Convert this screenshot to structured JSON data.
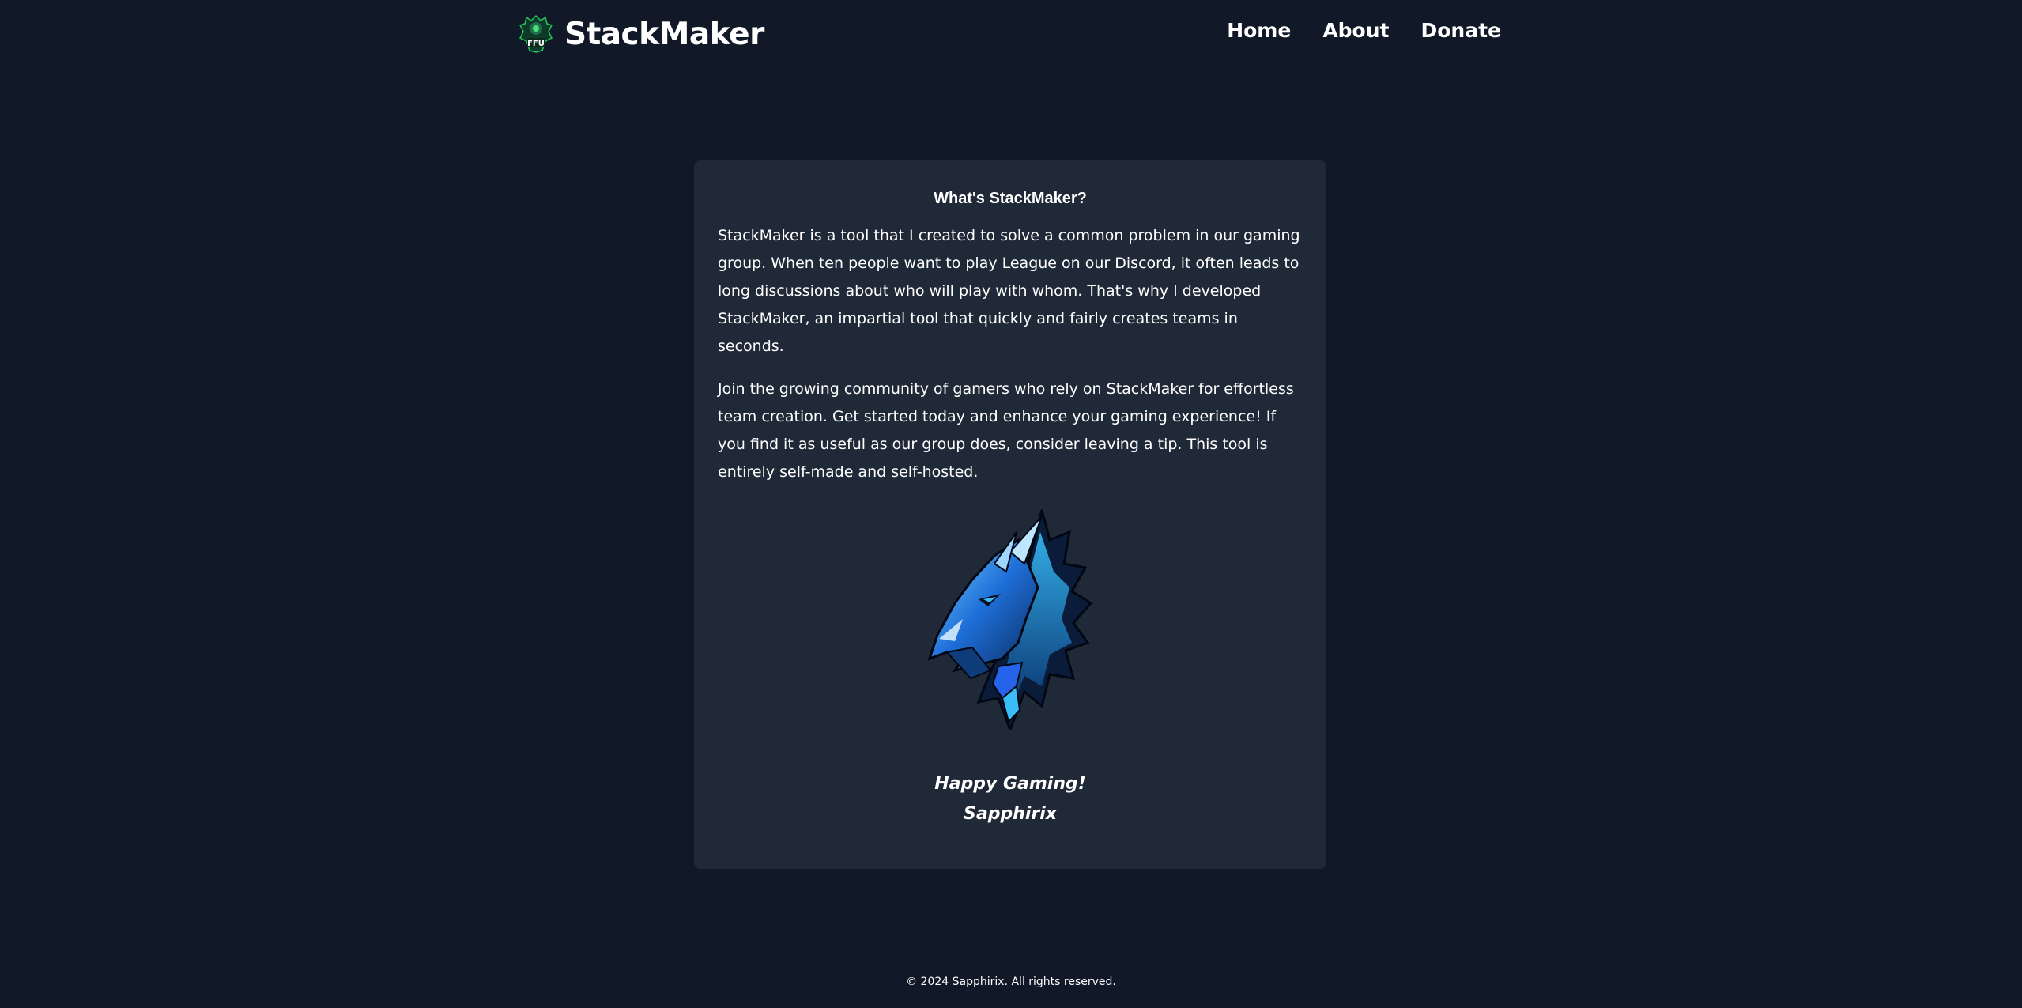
{
  "header": {
    "brand_name": "StackMaker",
    "logo_icon": "ffu-shield-logo-icon",
    "nav": [
      {
        "label": "Home"
      },
      {
        "label": "About"
      },
      {
        "label": "Donate"
      }
    ]
  },
  "card": {
    "title": "What's StackMaker?",
    "paragraphs": [
      "StackMaker is a tool that I created to solve a common problem in our gaming group. When ten people want to play League on our Discord, it often leads to long discussions about who will play with whom. That's why I developed StackMaker, an impartial tool that quickly and fairly creates teams in seconds.",
      "Join the growing community of gamers who rely on StackMaker for effortless team creation. Get started today and enhance your gaming experience! If you find it as useful as our group does, consider leaving a tip. This tool is entirely self-made and self-hosted."
    ],
    "image_icon": "blue-dragon-icon",
    "signoff_line1": "Happy Gaming!",
    "signoff_line2": "Sapphirix"
  },
  "footer": {
    "copyright": "© 2024 Sapphirix. All rights reserved."
  },
  "colors": {
    "page_bg": "#111827",
    "card_bg": "#1f2937",
    "text": "#ffffff",
    "logo_green": "#22c55e",
    "dragon_blue": "#1e90ff"
  }
}
